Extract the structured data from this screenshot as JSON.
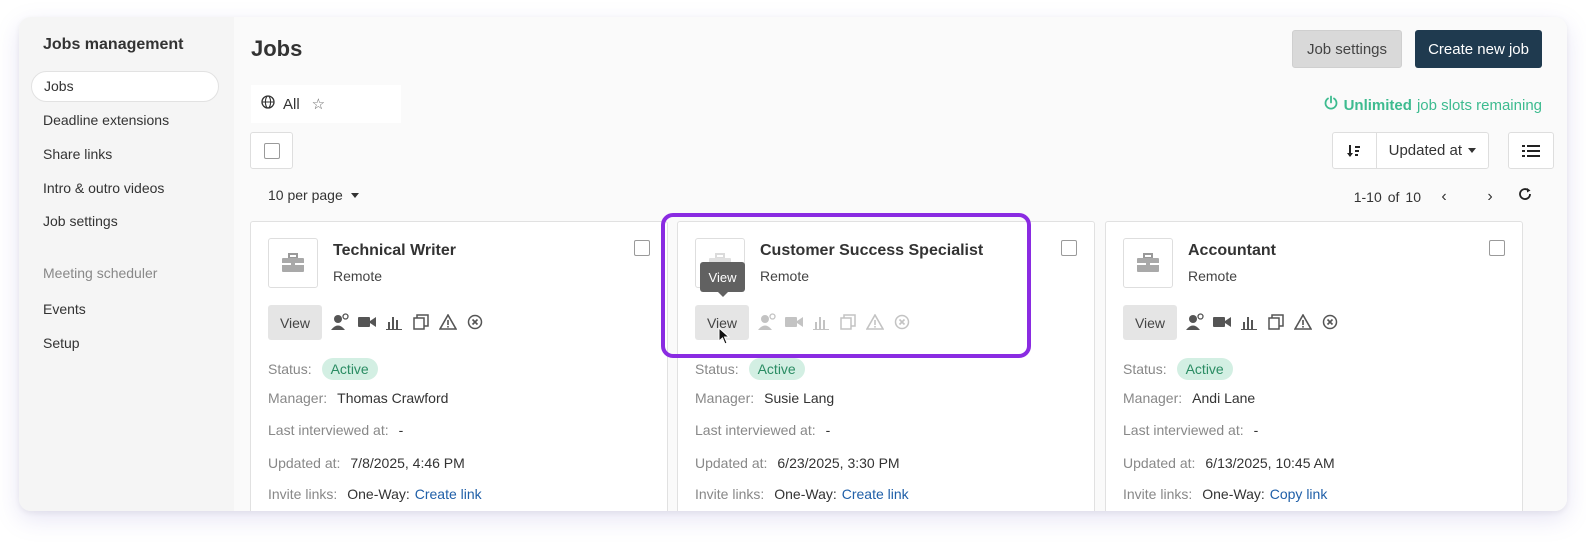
{
  "sidebar": {
    "title": "Jobs management",
    "items": [
      {
        "label": "Jobs"
      },
      {
        "label": "Deadline extensions"
      },
      {
        "label": "Share links"
      },
      {
        "label": "Intro & outro videos"
      },
      {
        "label": "Job settings"
      }
    ],
    "section_label": "Meeting scheduler",
    "scheduler_items": [
      {
        "label": "Events"
      },
      {
        "label": "Setup"
      }
    ]
  },
  "header": {
    "title": "Jobs",
    "settings_label": "Job settings",
    "create_label": "Create new job"
  },
  "filter": {
    "tab_label": "All"
  },
  "slots": {
    "strong": "Unlimited",
    "rest": "job slots remaining",
    "color": "#3dbb8f"
  },
  "sort": {
    "field": "Updated at"
  },
  "pagination": {
    "per_page": "10 per page",
    "range": "1-10",
    "of": "of",
    "total": "10"
  },
  "labels": {
    "view": "View",
    "status": "Status:",
    "manager": "Manager:",
    "last_interviewed": "Last interviewed at:",
    "updated": "Updated at:",
    "invite": "Invite links:",
    "one_way": "One-Way:"
  },
  "jobs": [
    {
      "title": "Technical Writer",
      "location": "Remote",
      "status": "Active",
      "manager": "Thomas Crawford",
      "last_interviewed": "-",
      "updated": "7/8/2025, 4:46 PM",
      "invite_link": "Create link"
    },
    {
      "title": "Customer Success Specialist",
      "location": "Remote",
      "status": "Active",
      "manager": "Susie Lang",
      "last_interviewed": "-",
      "updated": "6/23/2025, 3:30 PM",
      "invite_link": "Create link"
    },
    {
      "title": "Accountant",
      "location": "Remote",
      "status": "Active",
      "manager": "Andi Lane",
      "last_interviewed": "-",
      "updated": "6/13/2025, 10:45 AM",
      "invite_link": "Copy link"
    }
  ],
  "tooltip": {
    "text": "View"
  },
  "colors": {
    "primary": "#1f3a4f",
    "highlight": "#8a2be2",
    "active_badge_bg": "#d3efe3",
    "link": "#1f5fa8"
  }
}
